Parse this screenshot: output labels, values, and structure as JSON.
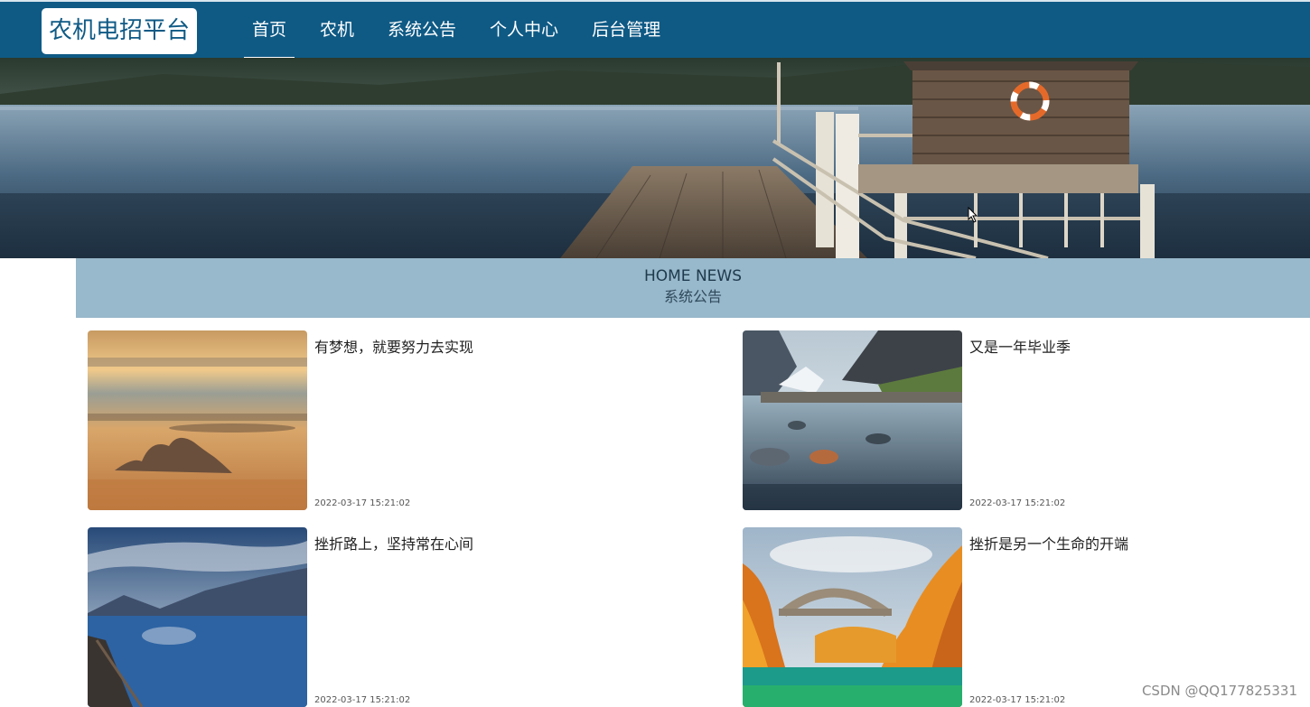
{
  "header": {
    "logo": "农机电招平台",
    "nav": [
      {
        "label": "首页",
        "active": true
      },
      {
        "label": "农机",
        "active": false
      },
      {
        "label": "系统公告",
        "active": false
      },
      {
        "label": "个人中心",
        "active": false
      },
      {
        "label": "后台管理",
        "active": false
      }
    ]
  },
  "banner": {
    "slide_count": 3,
    "active_slide": 1
  },
  "news": {
    "title_en": "HOME NEWS",
    "title_cn": "系统公告",
    "items": [
      {
        "title": "有梦想，就要努力去实现",
        "date": "2022-03-17 15:21:02"
      },
      {
        "title": "又是一年毕业季",
        "date": "2022-03-17 15:21:02"
      },
      {
        "title": "挫折路上，坚持常在心间",
        "date": "2022-03-17 15:21:02"
      },
      {
        "title": "挫折是另一个生命的开端",
        "date": "2022-03-17 15:21:02"
      }
    ]
  },
  "watermark": "CSDN @QQ177825331",
  "colors": {
    "nav_bg": "#0f5a85",
    "news_header_bg": "#98b8cb"
  }
}
